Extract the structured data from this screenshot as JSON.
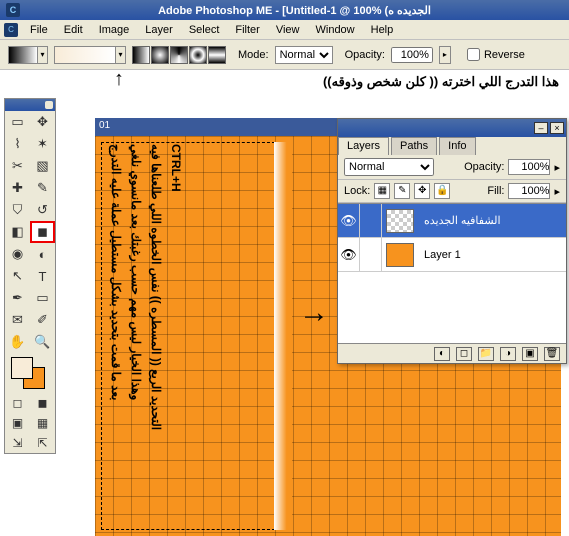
{
  "titlebar": {
    "app": "Adobe Photoshop ME - [Untitled-1 @ 100% (الجديده ه"
  },
  "menu": {
    "file": "File",
    "edit": "Edit",
    "image": "Image",
    "layer": "Layer",
    "select": "Select",
    "filter": "Filter",
    "view": "View",
    "window": "Window",
    "help": "Help"
  },
  "options": {
    "mode_label": "Mode:",
    "mode_value": "Normal",
    "opacity_label": "Opacity:",
    "opacity_value": "100%",
    "reverse_label": "Reverse"
  },
  "annotation": "هذا التدرج اللي اخترته  (( كلن شخص وذوقه))",
  "canvas": {
    "doc_label": "01",
    "vtext1": "بعد ما قمت بتحديد بشكل مستطيل عملة عليه التدرج",
    "vtext2": "وهذا الخيار ليس مهم  حسب رغبتك بعد مانسوي نلغي",
    "vtext3": "التحديد الريع (( المسطره )) نفس الخطوه اللي طلعناها فيه",
    "vtext4": "CTRL+H"
  },
  "layers": {
    "tabs": {
      "layers": "Layers",
      "paths": "Paths",
      "info": "Info"
    },
    "blend_value": "Normal",
    "opacity_label": "Opacity:",
    "opacity_value": "100%",
    "lock_label": "Lock:",
    "fill_label": "Fill:",
    "fill_value": "100%",
    "items": [
      {
        "name": "الشفافيه الجديده",
        "selected": true,
        "thumb": "checker"
      },
      {
        "name": "Layer 1",
        "selected": false,
        "thumb": "orange"
      }
    ]
  },
  "colors": {
    "accent": "#f7931e",
    "fg": "#f8ecd8"
  }
}
